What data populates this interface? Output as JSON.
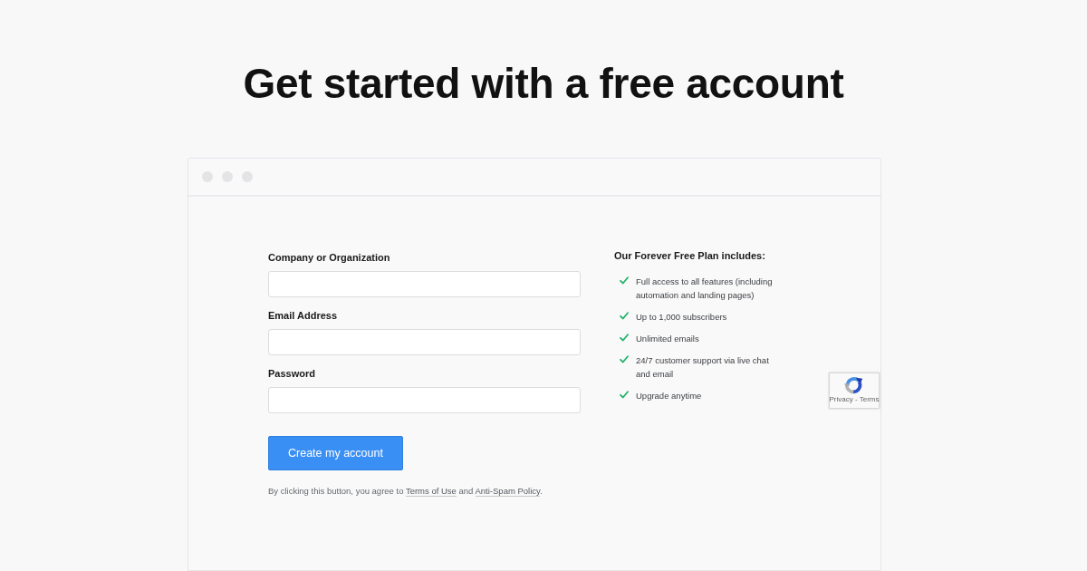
{
  "heading": "Get started with a free account",
  "form": {
    "fields": [
      {
        "label": "Company or Organization"
      },
      {
        "label": "Email Address"
      },
      {
        "label": "Password"
      }
    ],
    "submit": "Create my account",
    "disclaimer": [
      {
        "kind": "text",
        "text": "By clicking this button, you agree to "
      },
      {
        "kind": "link",
        "text": "Terms of Use"
      },
      {
        "kind": "text",
        "text": " and "
      },
      {
        "kind": "link",
        "text": "Anti-Spam Policy"
      },
      {
        "kind": "text",
        "text": "."
      }
    ]
  },
  "plan": {
    "title": "Our Forever Free Plan includes:",
    "items": [
      "Full access to all features (including automation and landing pages)",
      "Up to 1,000 subscribers",
      "Unlimited emails",
      "24/7 customer support via live chat and email",
      "Upgrade anytime"
    ]
  },
  "recaptcha": {
    "caption": "Privacy - Terms"
  }
}
